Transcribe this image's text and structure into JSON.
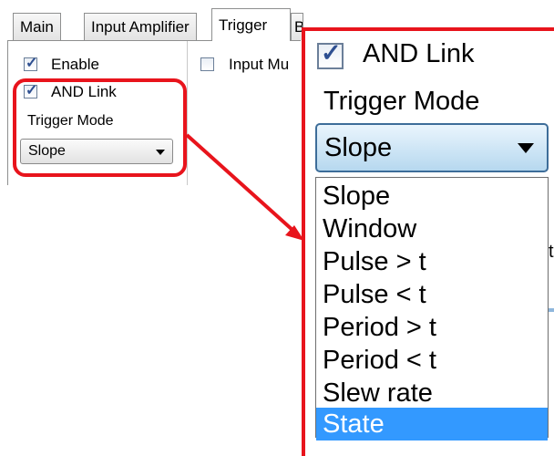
{
  "tabs": [
    {
      "label": "Main",
      "active": false
    },
    {
      "label": "Input Amplifier",
      "active": false
    },
    {
      "label": "Trigger",
      "active": true
    },
    {
      "label": "Bl",
      "active": false
    }
  ],
  "trigger_panel": {
    "enable": {
      "label": "Enable",
      "checked": true
    },
    "and_link": {
      "label": "AND Link",
      "checked": true
    },
    "input_mux": {
      "label": "Input Mu",
      "checked": false
    },
    "trigger_mode_label": "Trigger Mode",
    "trigger_mode_value": "Slope"
  },
  "zoom": {
    "and_link": {
      "label": "AND Link",
      "checked": true
    },
    "trigger_mode_label": "Trigger Mode",
    "trigger_mode_value": "Slope",
    "options": [
      "Slope",
      "Window",
      "Pulse > t",
      "Pulse < t",
      "Period > t",
      "Period < t",
      "Slew rate",
      "State"
    ],
    "selected_option": "State",
    "background_stub_text": "t"
  },
  "colors": {
    "highlight": "#e8141c",
    "selection": "#3399ff",
    "combo_focus_border": "#3d6d99"
  }
}
